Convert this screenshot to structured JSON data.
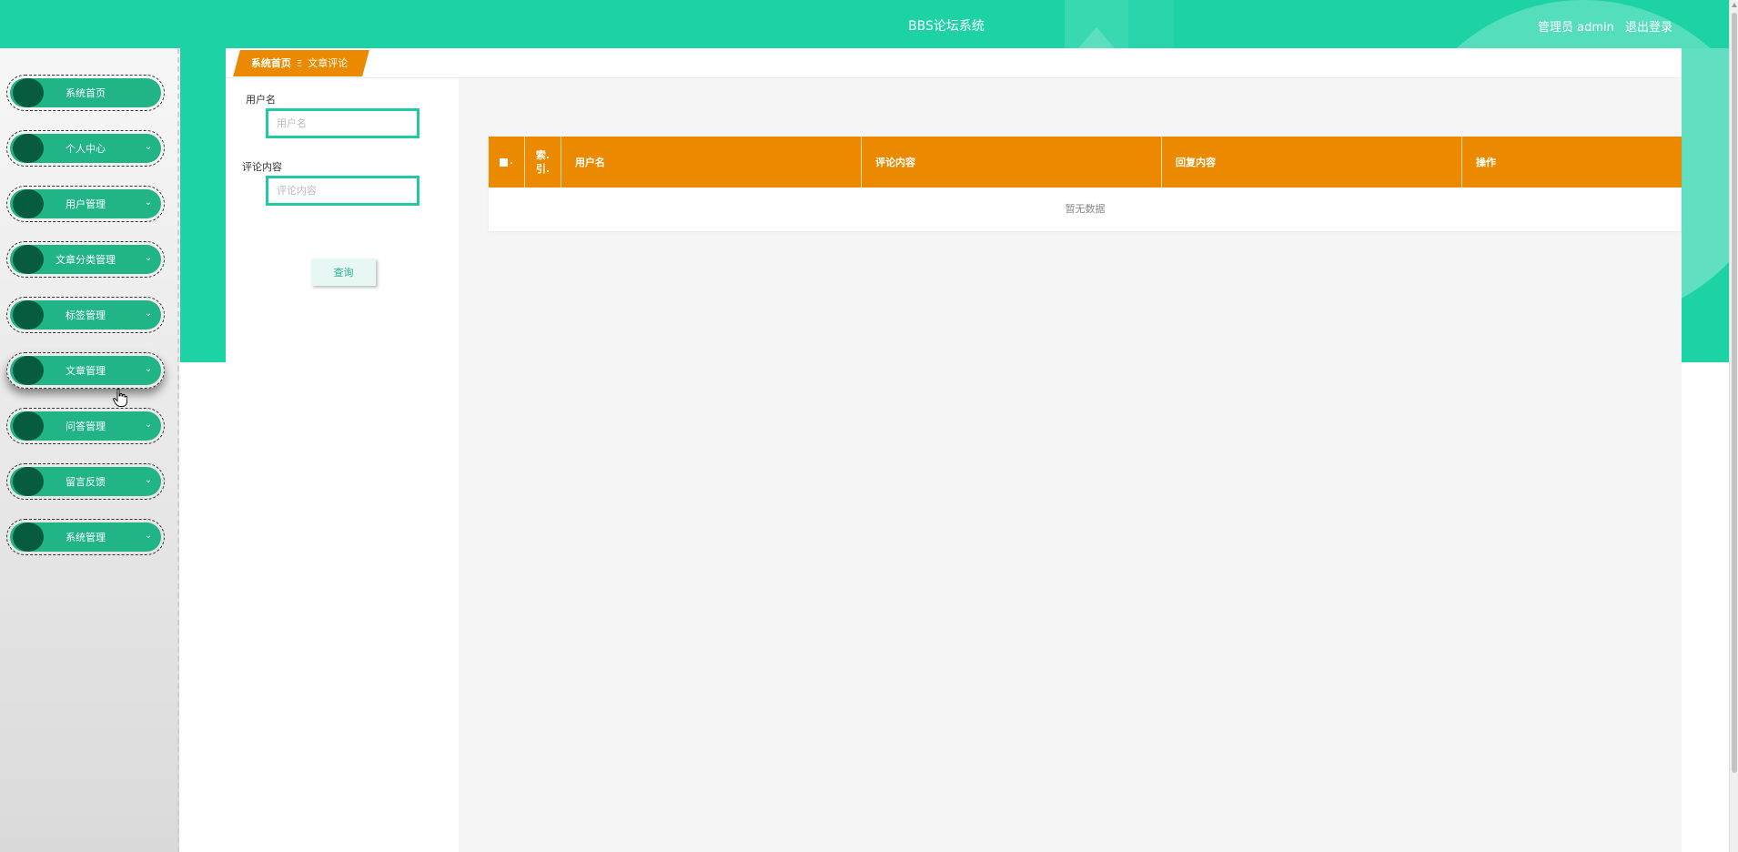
{
  "header": {
    "title": "BBS论坛系统",
    "user_label": "管理员 admin",
    "logout_label": "退出登录"
  },
  "sidebar": {
    "items": [
      {
        "label": "系统首页",
        "has_arrow": false
      },
      {
        "label": "个人中心",
        "has_arrow": true
      },
      {
        "label": "用户管理",
        "has_arrow": true
      },
      {
        "label": "文章分类管理",
        "has_arrow": true
      },
      {
        "label": "标签管理",
        "has_arrow": true
      },
      {
        "label": "文章管理",
        "has_arrow": true
      },
      {
        "label": "问答管理",
        "has_arrow": true
      },
      {
        "label": "留言反馈",
        "has_arrow": true
      },
      {
        "label": "系统管理",
        "has_arrow": true
      }
    ],
    "active_item": "文章管理"
  },
  "breadcrumb": {
    "home": "系统首页",
    "separator": "Ξ",
    "current": "文章评论"
  },
  "search": {
    "username_label": "用户名",
    "username_placeholder": "用户名",
    "username_value": "",
    "comment_label": "评论内容",
    "comment_placeholder": "评论内容",
    "comment_value": "",
    "query_button": "查询"
  },
  "table": {
    "columns": {
      "select": "■.",
      "index": "索.\n引.",
      "username": "用户名",
      "comment": "评论内容",
      "reply": "回复内容",
      "actions": "操作"
    },
    "rows": [],
    "empty_text": "暂无数据"
  },
  "colors": {
    "header_teal": "#1dd3a6",
    "menu_green": "#20b487",
    "menu_dot": "#075b3f",
    "accent_orange": "#eb8a00",
    "input_border": "#23c9a0"
  },
  "icons": {
    "menu_arrow": "chevron-down-icon",
    "cursor": "hand-pointer-icon"
  }
}
